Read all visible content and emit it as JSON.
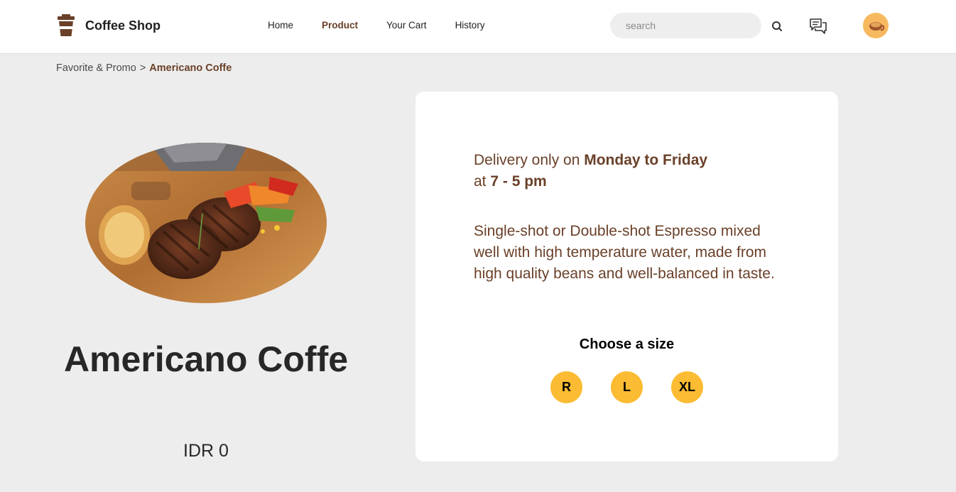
{
  "header": {
    "brand": "Coffee Shop",
    "nav": [
      {
        "label": "Home"
      },
      {
        "label": "Product"
      },
      {
        "label": "Your Cart"
      },
      {
        "label": "History"
      }
    ],
    "active_nav": "Product",
    "search_placeholder": "search",
    "icons": [
      "coffee-cup-logo-icon",
      "search-icon",
      "chat-icon",
      "avatar"
    ]
  },
  "breadcrumb": {
    "parent": "Favorite & Promo",
    "separator": ">",
    "current": "Americano Coffe"
  },
  "product": {
    "name": "Americano Coffe",
    "price": "IDR 0",
    "image": "grilled steak with vegetables on wooden board"
  },
  "details": {
    "delivery_prefix": "Delivery only on ",
    "delivery_days": "Monday to Friday",
    "delivery_at": "at ",
    "delivery_hours": "7 - 5 pm",
    "description": "Single-shot or Double-shot Espresso mixed well with high temperature water, made from high quality beans and well-balanced in taste.",
    "size_title": "Choose a size",
    "sizes": [
      "R",
      "L",
      "XL"
    ]
  },
  "colors": {
    "brand_brown": "#6a4029",
    "size_yellow": "#fbbb32",
    "page_bg": "#ededed",
    "card_bg": "#ffffff"
  }
}
